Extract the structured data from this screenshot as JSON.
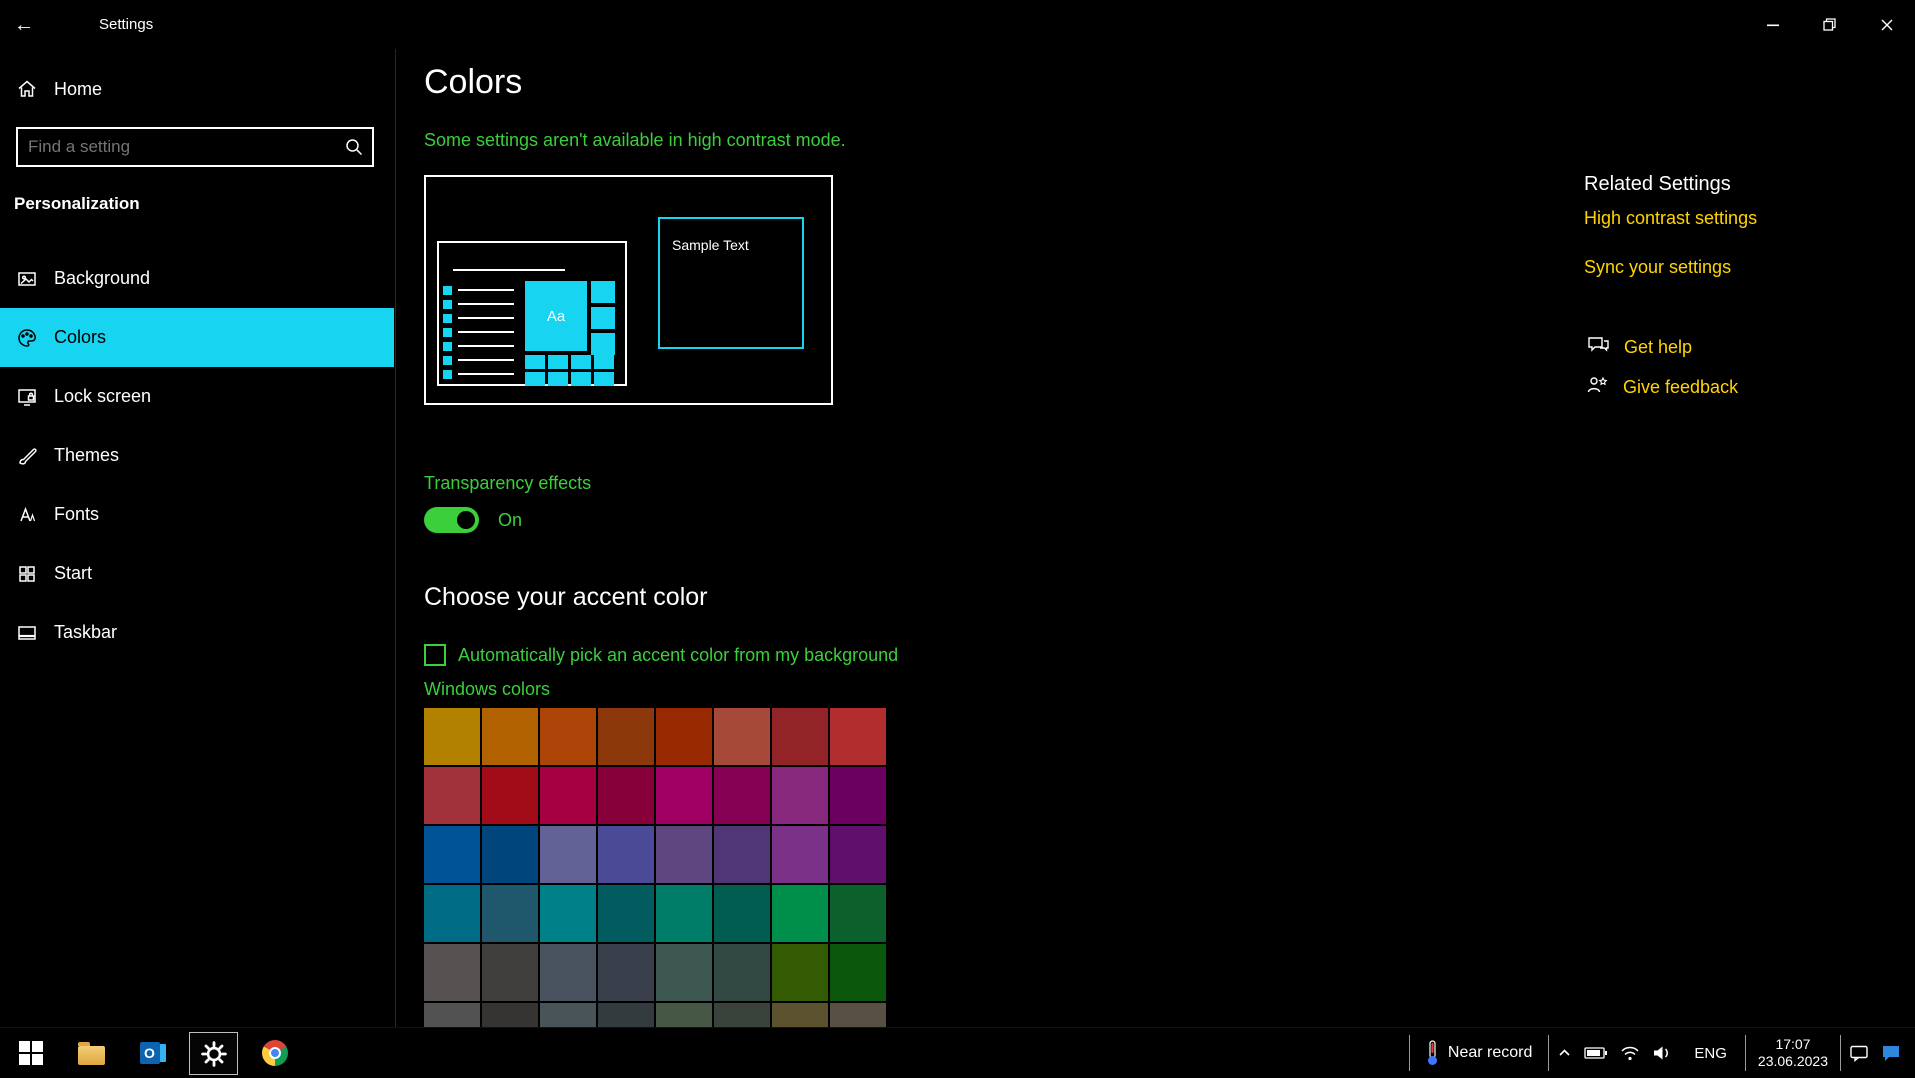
{
  "theme": {
    "bg": "#000000",
    "text": "#ffffff",
    "hc-green": "#3bcf3b",
    "link-yellow": "#ffd400",
    "accent-cyan": "#17d4f0",
    "selected-text": "#000000",
    "tray-chat-blue": "#2e86de"
  },
  "titlebar": {
    "title": "Settings"
  },
  "sidebar": {
    "home": "Home",
    "search_placeholder": "Find a setting",
    "section": "Personalization",
    "items": [
      {
        "label": "Background",
        "selected": false
      },
      {
        "label": "Colors",
        "selected": true
      },
      {
        "label": "Lock screen",
        "selected": false
      },
      {
        "label": "Themes",
        "selected": false
      },
      {
        "label": "Fonts",
        "selected": false
      },
      {
        "label": "Start",
        "selected": false
      },
      {
        "label": "Taskbar",
        "selected": false
      }
    ]
  },
  "main": {
    "title": "Colors",
    "notice": "Some settings aren't available in high contrast mode.",
    "preview": {
      "sample_text": "Sample Text",
      "tile_text": "Aa"
    },
    "transparency": {
      "label": "Transparency effects",
      "state": "On"
    },
    "accent": {
      "heading": "Choose your accent color",
      "auto_label": "Automatically pick an accent color from my background",
      "auto_checked": false,
      "windows_colors_label": "Windows colors",
      "swatches": [
        "#b28100",
        "#b26200",
        "#ad4508",
        "#8d380b",
        "#992901",
        "#a74938",
        "#922427",
        "#b22e2e",
        "#a1323c",
        "#a20c19",
        "#a40042",
        "#880039",
        "#9f0062",
        "#860053",
        "#88287d",
        "#6c0060",
        "#005496",
        "#00457c",
        "#636297",
        "#4b4a96",
        "#5e4681",
        "#513676",
        "#7c3188",
        "#5f106a",
        "#006b84",
        "#1f586c",
        "#008088",
        "#025c5f",
        "#007d68",
        "#015d51",
        "#008f4a",
        "#0b602b",
        "#555251",
        "#413f3e",
        "#495360",
        "#39404b",
        "#3c5750",
        "#324943",
        "#335b04",
        "#0b570b",
        "#525252",
        "#353433",
        "#495458",
        "#343b3e",
        "#465746",
        "#39423b",
        "#5c5230",
        "#585043"
      ]
    }
  },
  "related": {
    "heading": "Related Settings",
    "links": [
      {
        "label": "High contrast settings"
      },
      {
        "label": "Sync your settings"
      }
    ],
    "help": [
      {
        "label": "Get help"
      },
      {
        "label": "Give feedback"
      }
    ]
  },
  "taskbar": {
    "weather": "Near record",
    "language": "ENG",
    "time": "17:07",
    "date": "23.06.2023"
  }
}
